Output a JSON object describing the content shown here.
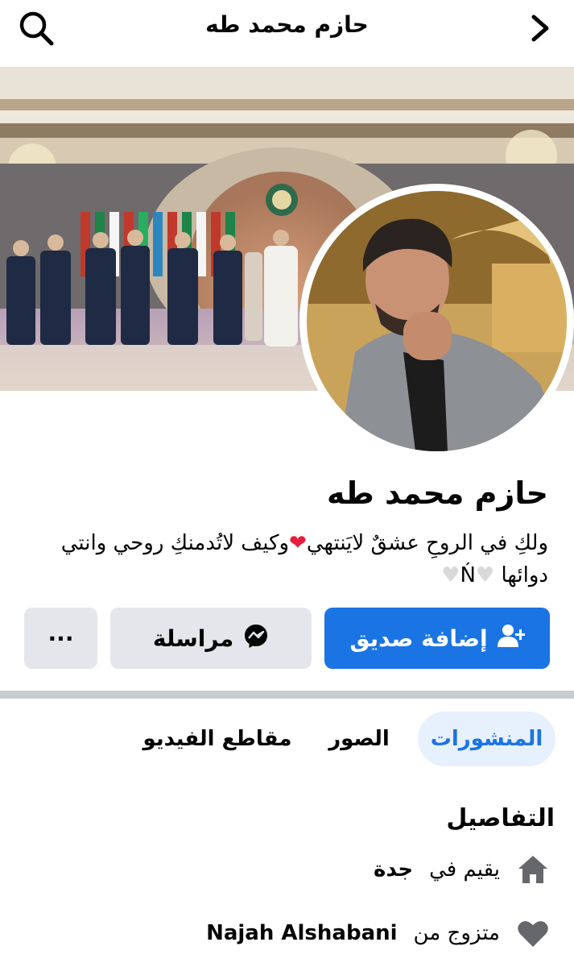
{
  "header": {
    "title": "حازم محمد طه",
    "search_icon": "search-icon",
    "back_icon": "chevron-right-icon"
  },
  "profile": {
    "name": "حازم محمد طه",
    "bio_part1": "ولكِ في الروحِ عشقٌ لايَنتهي",
    "bio_part2": "وكيف لاتُدمنكِ روحي وانتي دوائها",
    "bio_letter": "Ń"
  },
  "actions": {
    "add_friend": "إضافة صديق",
    "message": "مراسلة",
    "more": "···"
  },
  "tabs": [
    {
      "label": "المنشورات",
      "active": true
    },
    {
      "label": "الصور",
      "active": false
    },
    {
      "label": "مقاطع الفيديو",
      "active": false
    }
  ],
  "details": {
    "title": "التفاصيل",
    "lives_prefix": "يقيم في",
    "city": "جدة",
    "married_prefix": "متزوج من",
    "spouse": "Najah Alshabani"
  },
  "colors": {
    "primary": "#1b74e4",
    "button_grey": "#e4e6eb",
    "active_tab_bg": "#e7f0fd",
    "divider": "#c9ccd1",
    "icon_grey": "#65676b"
  }
}
